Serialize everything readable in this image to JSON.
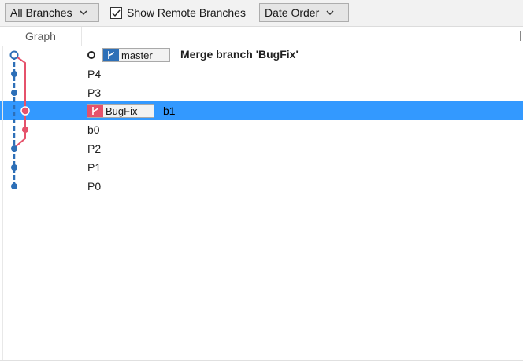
{
  "toolbar": {
    "branches_dropdown": "All Branches",
    "show_remote_label": "Show Remote Branches",
    "show_remote_checked": true,
    "order_dropdown": "Date Order"
  },
  "columns": {
    "graph": "Graph"
  },
  "commits": [
    {
      "message": "Merge branch 'BugFix'",
      "branch": "master",
      "branch_color": "#2d6fb7"
    },
    {
      "message": "P4"
    },
    {
      "message": "P3"
    },
    {
      "message": "b1",
      "branch": "BugFix",
      "branch_color": "#e5526b",
      "selected": true
    },
    {
      "message": "b0"
    },
    {
      "message": "P2"
    },
    {
      "message": "P1"
    },
    {
      "message": "P0"
    }
  ],
  "colors": {
    "selection": "#3399ff",
    "master_line": "#2d6fb7",
    "bugfix_line": "#e5526b"
  },
  "icons": [
    "chevron-down-icon",
    "checkmark-icon",
    "branch-icon",
    "commit-node-icon"
  ]
}
